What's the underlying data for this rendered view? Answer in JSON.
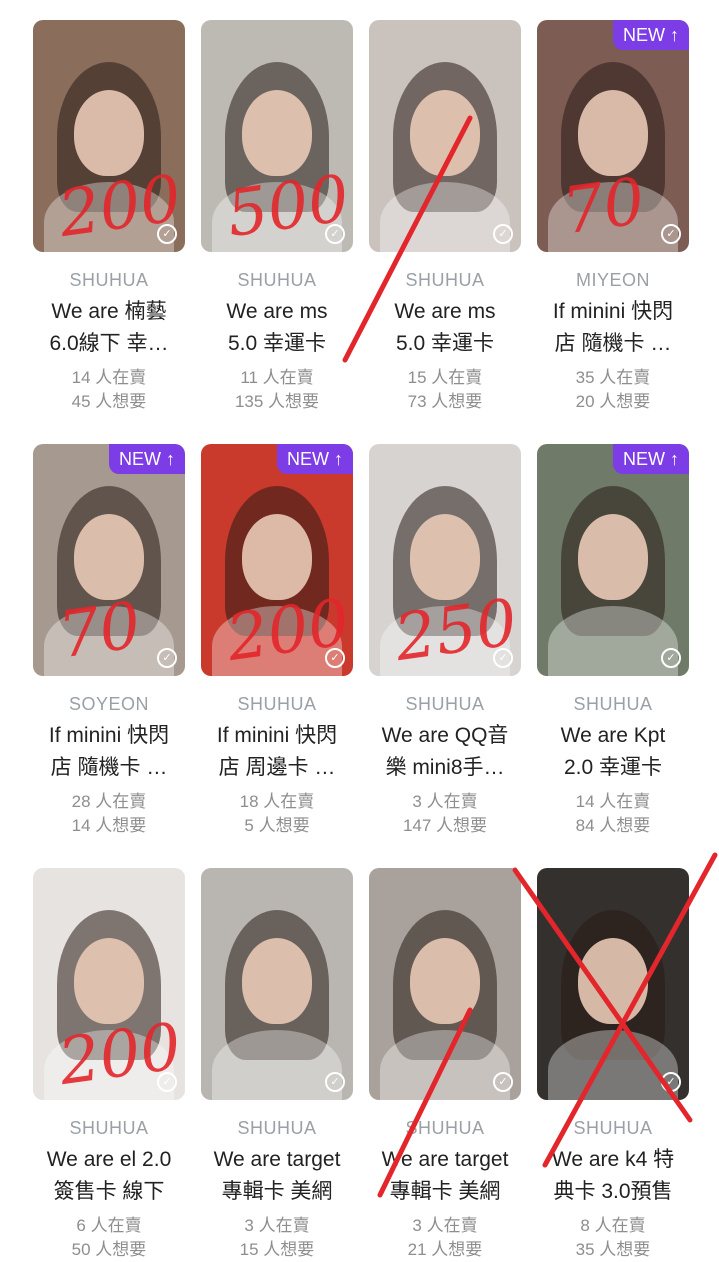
{
  "accent": "#7c3ce6",
  "markup_color": "#e3262b",
  "cards": [
    {
      "brand": "SHUHUA",
      "title1": "We are 楠藝",
      "title2": "6.0線下 幸…",
      "stat1": "14 人在賣",
      "stat2": "45 人想要",
      "badge": "",
      "bg": "#8b6d5c",
      "note": "200"
    },
    {
      "brand": "SHUHUA",
      "title1": "We are ms",
      "title2": "5.0 幸運卡",
      "stat1": "11 人在賣",
      "stat2": "135 人想要",
      "badge": "",
      "bg": "#bdbab4",
      "note": "500"
    },
    {
      "brand": "SHUHUA",
      "title1": "We are ms",
      "title2": "5.0 幸運卡",
      "stat1": "15 人在賣",
      "stat2": "73 人想要",
      "badge": "",
      "bg": "#c9c2bd",
      "note": ""
    },
    {
      "brand": "MIYEON",
      "title1": "If minini 快閃",
      "title2": "店 隨機卡 …",
      "stat1": "35 人在賣",
      "stat2": "20 人想要",
      "badge": "NEW ↑",
      "bg": "#7d5c53",
      "note": "70"
    },
    {
      "brand": "SOYEON",
      "title1": "If minini 快閃",
      "title2": "店 隨機卡 …",
      "stat1": "28 人在賣",
      "stat2": "14 人想要",
      "badge": "NEW ↑",
      "bg": "#a69a90",
      "note": "70"
    },
    {
      "brand": "SHUHUA",
      "title1": "If minini 快閃",
      "title2": "店 周邊卡 …",
      "stat1": "18 人在賣",
      "stat2": "5 人想要",
      "badge": "NEW ↑",
      "bg": "#c93a2c",
      "note": "200"
    },
    {
      "brand": "SHUHUA",
      "title1": "We are QQ音",
      "title2": "樂 mini8手…",
      "stat1": "3 人在賣",
      "stat2": "147 人想要",
      "badge": "",
      "bg": "#d6d3d0",
      "note": "250"
    },
    {
      "brand": "SHUHUA",
      "title1": "We are Kpt",
      "title2": "2.0 幸運卡",
      "stat1": "14 人在賣",
      "stat2": "84 人想要",
      "badge": "NEW ↑",
      "bg": "#6f7a68",
      "note": ""
    },
    {
      "brand": "SHUHUA",
      "title1": "We are el 2.0",
      "title2": "簽售卡 線下",
      "stat1": "6 人在賣",
      "stat2": "50 人想要",
      "badge": "",
      "bg": "#e7e3e0",
      "note": "200"
    },
    {
      "brand": "SHUHUA",
      "title1": "We are target",
      "title2": "專輯卡 美網",
      "stat1": "3 人在賣",
      "stat2": "15 人想要",
      "badge": "",
      "bg": "#b9b5b0",
      "note": ""
    },
    {
      "brand": "SHUHUA",
      "title1": "We are target",
      "title2": "專輯卡 美網",
      "stat1": "3 人在賣",
      "stat2": "21 人想要",
      "badge": "",
      "bg": "#a9a29c",
      "note": ""
    },
    {
      "brand": "SHUHUA",
      "title1": "We are k4 特",
      "title2": "典卡 3.0預售",
      "stat1": "8 人在賣",
      "stat2": "35 人想要",
      "badge": "",
      "bg": "#33302e",
      "note": ""
    }
  ]
}
